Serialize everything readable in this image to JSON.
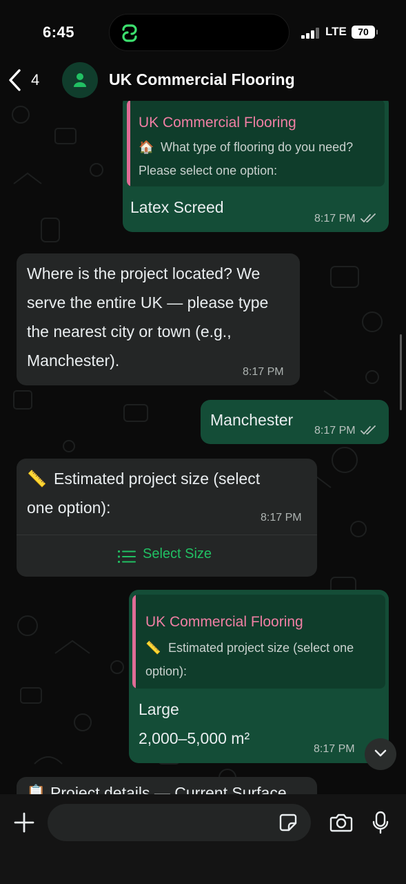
{
  "status_bar": {
    "time": "6:45",
    "network": "LTE",
    "battery": "70"
  },
  "header": {
    "back_count": "4",
    "title": "UK Commercial Flooring"
  },
  "messages": [
    {
      "direction": "out",
      "quote_name": "UK Commercial Flooring",
      "quote_emoji": "🏠",
      "quote_text_1": "What type of flooring do you need?",
      "quote_text_2": "Please select one option:",
      "text": "Latex Screed",
      "time": "8:17 PM",
      "status": "read"
    },
    {
      "direction": "in",
      "lines": [
        "Where is the project located? We",
        "serve the entire UK — please type",
        "the nearest city or town (e.g.,",
        "Manchester)."
      ],
      "time": "8:17 PM"
    },
    {
      "direction": "out",
      "text": "Manchester",
      "time": "8:17 PM",
      "status": "read"
    },
    {
      "direction": "in",
      "emoji": "📏",
      "line_1": "Estimated project size (select",
      "line_2": "one option):",
      "time": "8:17 PM",
      "button_label": "Select Size"
    },
    {
      "direction": "out",
      "quote_name": "UK Commercial Flooring",
      "quote_emoji": "📏",
      "quote_text_1": "Estimated project size (select one",
      "quote_text_2": "option):",
      "text_1": "Large",
      "text_2": "2,000–5,000 m²",
      "time": "8:17 PM",
      "status": "read"
    },
    {
      "direction": "in",
      "partial_text": "📋 Project details — Current Surface"
    }
  ],
  "colors": {
    "outgoing_bubble": "#144d37",
    "incoming_bubble": "#242626",
    "quote_accent": "#e06c96",
    "action_green": "#21c063"
  },
  "icons": [
    "back-chevron-icon",
    "contact-avatar-icon",
    "list-icon",
    "chevron-down-icon",
    "plus-icon",
    "sticker-icon",
    "camera-icon",
    "microphone-icon"
  ]
}
